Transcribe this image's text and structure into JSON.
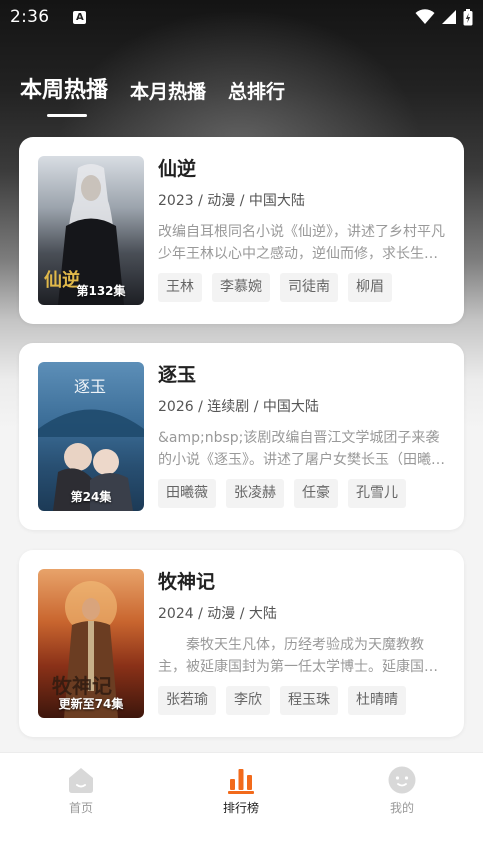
{
  "status_bar": {
    "time": "2:36",
    "notification_icon": "A"
  },
  "tabs": [
    {
      "label": "本周热播",
      "active": true
    },
    {
      "label": "本月热播",
      "active": false
    },
    {
      "label": "总排行",
      "active": false
    }
  ],
  "shows": [
    {
      "title": "仙逆",
      "meta": "2023 / 动漫 / 中国大陆",
      "desc": "改编自耳根同名小说《仙逆》，讲述了乡村平凡少年王林以心中之感动，逆仙而修，求长生之路的故事。",
      "episode": "第132集",
      "actors": [
        "王林",
        "李慕婉",
        "司徒南",
        "柳眉"
      ]
    },
    {
      "title": "逐玉",
      "meta": "2026 / 连续剧 / 中国大陆",
      "desc": "&amp;nbsp;该剧改编自晋江文学城团子来袭的小说《逐玉》。讲述了屠户女樊长玉（田曦薇 饰）的故事。",
      "episode": "第24集",
      "actors": [
        "田曦薇",
        "张凌赫",
        "任豪",
        "孔雪儿"
      ]
    },
    {
      "title": "牧神记",
      "meta": "2024 / 动漫 / 大陆",
      "desc": "　　秦牧天生凡体，历经考验成为天魔教教主，被延康国封为第一任太学博士。延康国师欲变法图强的故事。",
      "episode": "更新至74集",
      "actors": [
        "张若瑜",
        "李欣",
        "程玉珠",
        "杜晴晴"
      ]
    }
  ],
  "bottom_nav": [
    {
      "label": "首页",
      "icon": "home-icon",
      "active": false
    },
    {
      "label": "排行榜",
      "icon": "rank-icon",
      "active": true
    },
    {
      "label": "我的",
      "icon": "profile-icon",
      "active": false
    }
  ],
  "colors": {
    "accent": "#f26a1b",
    "inactive_icon": "#d8d8d8"
  }
}
